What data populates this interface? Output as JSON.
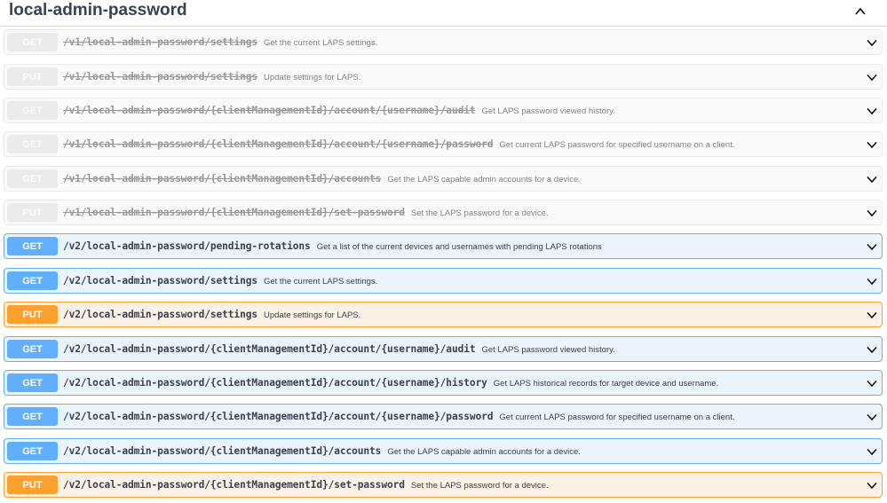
{
  "section": {
    "title": "local-admin-password"
  },
  "operations": [
    {
      "method": "GET",
      "kind": "deprecated",
      "path": "/v1/local-admin-password/settings",
      "summary": "Get the current LAPS settings."
    },
    {
      "method": "PUT",
      "kind": "deprecated",
      "path": "/v1/local-admin-password/settings",
      "summary": "Update settings for LAPS."
    },
    {
      "method": "GET",
      "kind": "deprecated",
      "path": "/v1/local-admin-password/{clientManagementId}/account/{username}/audit",
      "summary": "Get LAPS password viewed history."
    },
    {
      "method": "GET",
      "kind": "deprecated",
      "path": "/v1/local-admin-password/{clientManagementId}/account/{username}/password",
      "summary": "Get current LAPS password for specified username on a client."
    },
    {
      "method": "GET",
      "kind": "deprecated",
      "path": "/v1/local-admin-password/{clientManagementId}/accounts",
      "summary": "Get the LAPS capable admin accounts for a device."
    },
    {
      "method": "PUT",
      "kind": "deprecated",
      "path": "/v1/local-admin-password/{clientManagementId}/set-password",
      "summary": "Set the LAPS password for a device."
    },
    {
      "method": "GET",
      "kind": "get",
      "path": "/v2/local-admin-password/pending-rotations",
      "summary": "Get a list of the current devices and usernames with pending LAPS rotations"
    },
    {
      "method": "GET",
      "kind": "get",
      "path": "/v2/local-admin-password/settings",
      "summary": "Get the current LAPS settings."
    },
    {
      "method": "PUT",
      "kind": "put",
      "path": "/v2/local-admin-password/settings",
      "summary": "Update settings for LAPS."
    },
    {
      "method": "GET",
      "kind": "get",
      "path": "/v2/local-admin-password/{clientManagementId}/account/{username}/audit",
      "summary": "Get LAPS password viewed history."
    },
    {
      "method": "GET",
      "kind": "get",
      "path": "/v2/local-admin-password/{clientManagementId}/account/{username}/history",
      "summary": "Get LAPS historical records for target device and username."
    },
    {
      "method": "GET",
      "kind": "get",
      "path": "/v2/local-admin-password/{clientManagementId}/account/{username}/password",
      "summary": "Get current LAPS password for specified username on a client."
    },
    {
      "method": "GET",
      "kind": "get",
      "path": "/v2/local-admin-password/{clientManagementId}/accounts",
      "summary": "Get the LAPS capable admin accounts for a device."
    },
    {
      "method": "PUT",
      "kind": "put",
      "path": "/v2/local-admin-password/{clientManagementId}/set-password",
      "summary": "Set the LAPS password for a device."
    }
  ],
  "icons": {
    "collapse": "chevron-up-icon",
    "expand": "chevron-down-icon"
  },
  "colors": {
    "get": "#61affe",
    "put": "#fca130",
    "deprecated": "#ebebeb"
  }
}
